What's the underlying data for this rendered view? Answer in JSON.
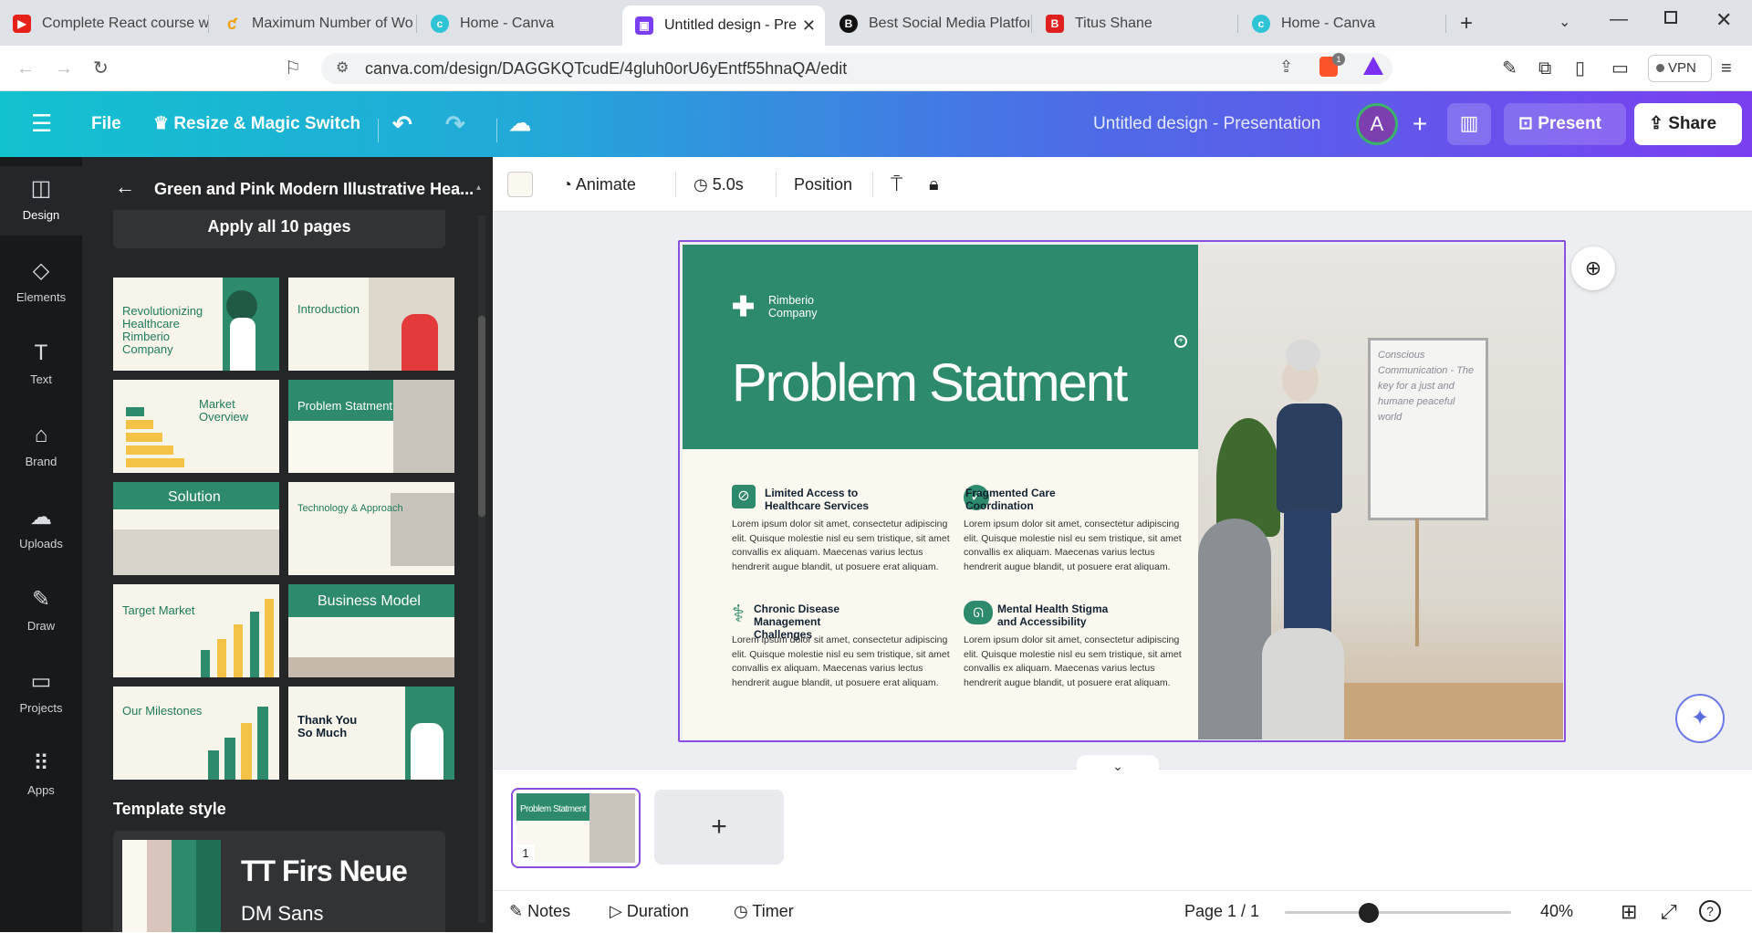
{
  "browser": {
    "tabs": [
      {
        "title": "Complete React course w",
        "color": "#e62117"
      },
      {
        "title": "Maximum Number of Wo",
        "color": "#f0a000"
      },
      {
        "title": "Home - Canva",
        "color": "#2ec4d6"
      },
      {
        "title": "Untitled design - Pre",
        "color": "#7a3ff0"
      },
      {
        "title": "Best Social Media Platfor",
        "color": "#111111"
      },
      {
        "title": "Titus Shane",
        "color": "#e02020"
      },
      {
        "title": "Home - Canva",
        "color": "#2ec4d6"
      }
    ],
    "url": "canva.com/design/DAGGKQTcudE/4gluh0orU6yEntf55hnaQA/edit",
    "vpn_label": "VPN",
    "brave_badge": "1"
  },
  "header": {
    "file": "File",
    "resize": "Resize & Magic Switch",
    "doc_title": "Untitled design - Presentation",
    "avatar": "A",
    "present": "Present",
    "share": "Share"
  },
  "sidebar": {
    "items": [
      {
        "label": "Design"
      },
      {
        "label": "Elements"
      },
      {
        "label": "Text"
      },
      {
        "label": "Brand"
      },
      {
        "label": "Uploads"
      },
      {
        "label": "Draw"
      },
      {
        "label": "Projects"
      },
      {
        "label": "Apps"
      }
    ]
  },
  "panel": {
    "title": "Green and Pink Modern Illustrative Hea...",
    "apply": "Apply all 10 pages",
    "thumbs": [
      "Revolutionizing Healthcare Rimberio Company",
      "Introduction",
      "Market Overview",
      "Problem Statment",
      "Solution",
      "Technology & Approach",
      "Target Market",
      "Business Model",
      "Our Milestones",
      "Thank You So Much"
    ],
    "template_style": "Template style",
    "font1": "TT Firs Neue",
    "font2": "DM Sans",
    "palette": [
      "#fbf8ef",
      "#d8c6bc",
      "#2e8a6c",
      "#1f6f55"
    ]
  },
  "toolbar": {
    "animate": "Animate",
    "duration": "5.0s",
    "position": "Position",
    "swatch": "#fbf8ef"
  },
  "slide": {
    "company": "Rimberio Company",
    "title": "Problem Statment",
    "sections": [
      {
        "title": "Limited Access to Healthcare Services",
        "body": "Lorem ipsum dolor sit amet, consectetur adipiscing elit. Quisque molestie nisl eu sem tristique, sit amet convallis ex aliquam. Maecenas varius lectus hendrerit augue blandit, ut posuere erat aliquam."
      },
      {
        "title": "Fragmented Care Coordination",
        "body": "Lorem ipsum dolor sit amet, consectetur adipiscing elit. Quisque molestie nisl eu sem tristique, sit amet convallis ex aliquam. Maecenas varius lectus hendrerit augue blandit, ut posuere erat aliquam."
      },
      {
        "title": "Chronic Disease Management Challenges",
        "body": "Lorem ipsum dolor sit amet, consectetur adipiscing elit. Quisque molestie nisl eu sem tristique, sit amet convallis ex aliquam. Maecenas varius lectus hendrerit augue blandit, ut posuere erat aliquam."
      },
      {
        "title": "Mental Health Stigma and Accessibility",
        "body": "Lorem ipsum dolor sit amet, consectetur adipiscing elit. Quisque molestie nisl eu sem tristique, sit amet convallis ex aliquam. Maecenas varius lectus hendrerit augue blandit, ut posuere erat aliquam."
      }
    ],
    "whiteboard_text": "Conscious Communication - The key for a just and humane  peaceful world",
    "green": "#2e8a6c"
  },
  "pages": {
    "thumb_title": "Problem Statment",
    "thumb_number": "1"
  },
  "bottom": {
    "notes": "Notes",
    "duration": "Duration",
    "timer": "Timer",
    "page": "Page 1 / 1",
    "zoom": "40%",
    "zoom_level": 0.36
  }
}
